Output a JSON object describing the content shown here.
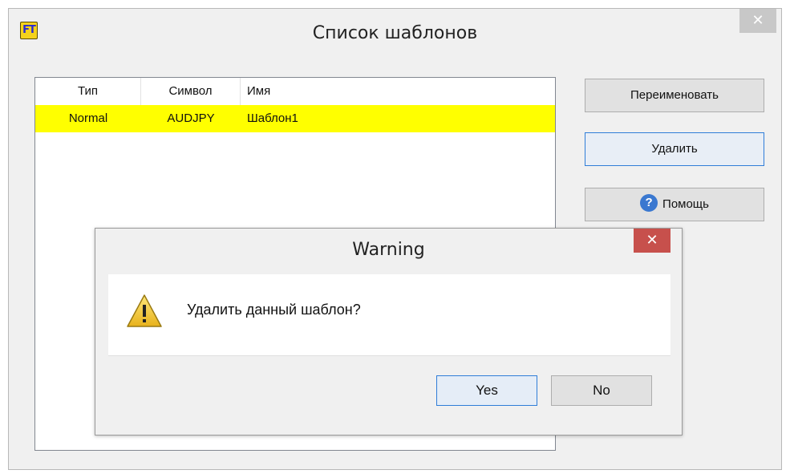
{
  "main_window": {
    "title": "Список шаблонов",
    "icon_text": "FT",
    "close_glyph": "✕"
  },
  "list": {
    "columns": [
      "Тип",
      "Символ",
      "Имя"
    ],
    "rows": [
      {
        "type": "Normal",
        "symbol": "AUDJPY",
        "name": "Шаблон1"
      }
    ],
    "selected_row_color": "#ffff00"
  },
  "buttons": {
    "rename": "Переименовать",
    "delete": "Удалить",
    "help": "Помощь",
    "help_icon": "question-icon"
  },
  "dialog": {
    "title": "Warning",
    "close_glyph": "✕",
    "message": "Удалить данный шаблон?",
    "icon": "warning-icon",
    "yes": "Yes",
    "no": "No",
    "close_color": "#c7504c"
  }
}
